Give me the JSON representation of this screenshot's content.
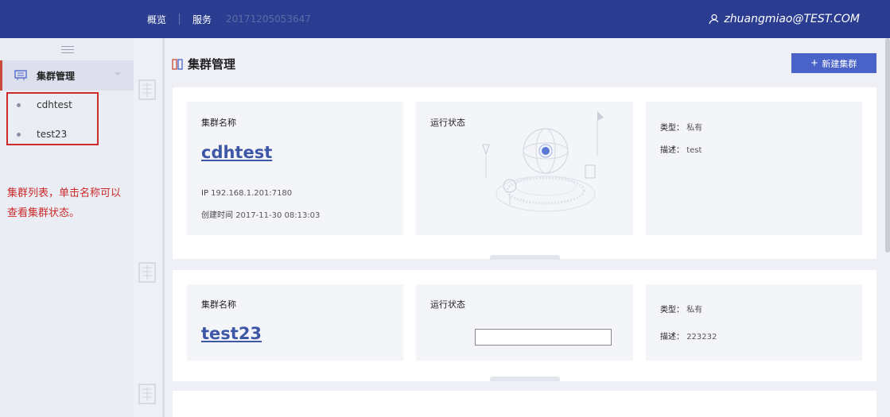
{
  "header": {
    "nav": [
      "概览",
      "服务"
    ],
    "cluster_id": "20171205053647",
    "user": "zhuangmiao@TEST.COM"
  },
  "sidebar": {
    "group_label": "集群管理",
    "items": [
      {
        "label": "cdhtest"
      },
      {
        "label": "test23"
      }
    ]
  },
  "annotation": "集群列表，单击名称可以查看集群状态。",
  "page": {
    "title": "集群管理",
    "new_button": "新建集群"
  },
  "labels": {
    "cluster_name": "集群名称",
    "run_status": "运行状态",
    "ip_prefix": "IP",
    "created_prefix": "创建时间",
    "type_prefix": "类型：",
    "desc_prefix": "描述："
  },
  "clusters": [
    {
      "name": "cdhtest",
      "ip": "192.168.1.201:7180",
      "created": "2017-11-30 08:13:03",
      "type": "私有",
      "desc": "test"
    },
    {
      "name": "test23",
      "type": "私有",
      "desc": "223232"
    }
  ],
  "colors": {
    "topbar": "#2b3d91",
    "accent": "#4a63c9",
    "link": "#3e56a6",
    "annotation": "#cc2a2a"
  }
}
